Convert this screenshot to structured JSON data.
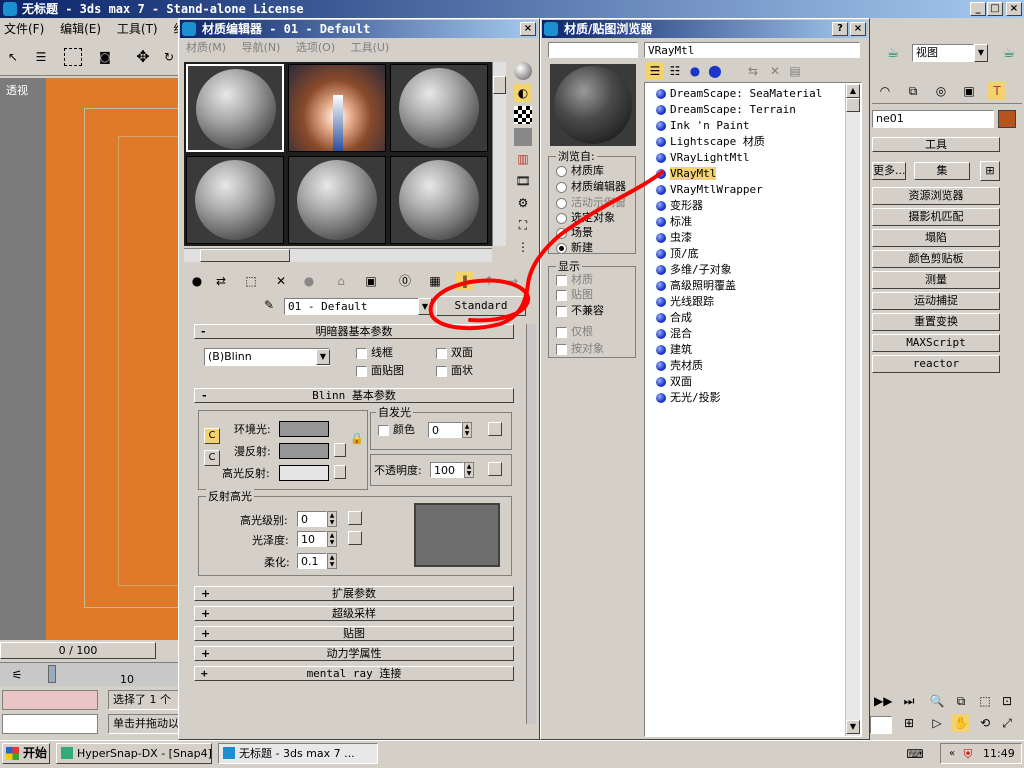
{
  "main": {
    "title": "无标题 - 3ds max 7 - Stand-alone License",
    "menu": [
      "文件(F)",
      "编辑(E)",
      "工具(T)",
      "组"
    ],
    "viewport_label": "透视",
    "time_slider": "0 / 100",
    "track_tick": "10",
    "status_selected": "选择了 1 个",
    "status_prompt": "单击并拖动以"
  },
  "mat_editor": {
    "title": "材质编辑器 - 01 - Default",
    "menu": [
      "材质(M)",
      "导航(N)",
      "选项(O)",
      "工具(U)"
    ],
    "material_name": "01 - Default",
    "type_button": "Standard",
    "rollouts": {
      "shader_basic": "明暗器基本参数",
      "blinn_basic": "Blinn 基本参数",
      "extended": "扩展参数",
      "supersampling": "超级采样",
      "maps": "贴图",
      "dynamics": "动力学属性",
      "mental_ray": "mental ray 连接"
    },
    "shader": {
      "selected": "(B)Blinn",
      "wire": "线框",
      "two_sided": "双面",
      "face_map": "面贴图",
      "faceted": "面状"
    },
    "blinn": {
      "ambient": "环境光:",
      "diffuse": "漫反射:",
      "specular": "高光反射:",
      "self_illum": "自发光",
      "color": "颜色",
      "color_value": "0",
      "opacity": "不透明度:",
      "opacity_value": "100",
      "spec_highlights": "反射高光",
      "spec_level": "高光级别:",
      "spec_level_value": "0",
      "glossiness": "光泽度:",
      "glossiness_value": "10",
      "soften": "柔化:",
      "soften_value": "0.1"
    },
    "plus": "+",
    "minus": "-"
  },
  "browser": {
    "title": "材质/贴图浏览器",
    "search_value": "",
    "selected_name": "VRayMtl",
    "browse_from_label": "浏览自:",
    "browse_from": [
      "材质库",
      "材质编辑器",
      "活动示例窗",
      "选定对象",
      "场景",
      "新建"
    ],
    "browse_selected": "新建",
    "show_label": "显示",
    "show": [
      "材质",
      "贴图",
      "不兼容"
    ],
    "root_only": "仅根",
    "by_object": "按对象",
    "items": [
      "DreamScape: SeaMaterial",
      "DreamScape: Terrain",
      "Ink 'n Paint",
      "Lightscape 材质",
      "VRayLightMtl",
      "VRayMtl",
      "VRayMtlWrapper",
      "变形器",
      "标准",
      "虫漆",
      "顶/底",
      "多维/子对象",
      "高级照明覆盖",
      "光线跟踪",
      "合成",
      "混合",
      "建筑",
      "壳材质",
      "双面",
      "无光/投影"
    ],
    "highlighted": "VRayMtl"
  },
  "right_panel": {
    "view_select": "视图",
    "object_name": "ne01",
    "utilities_header": "工具",
    "more_button": "更多...",
    "sets_button": "集",
    "utilities": [
      "资源浏览器",
      "摄影机匹配",
      "塌陷",
      "颜色剪贴板",
      "测量",
      "运动捕捉",
      "重置变换",
      "MAXScript",
      "reactor"
    ]
  },
  "taskbar": {
    "start": "开始",
    "tasks": [
      "HyperSnap-DX - [Snap4]",
      "无标题 - 3ds max 7 ..."
    ],
    "clock": "11:49"
  },
  "colors": {
    "viewport": "#e07a28",
    "annotation": "#ff0000",
    "titlebar": "#0a246a"
  }
}
